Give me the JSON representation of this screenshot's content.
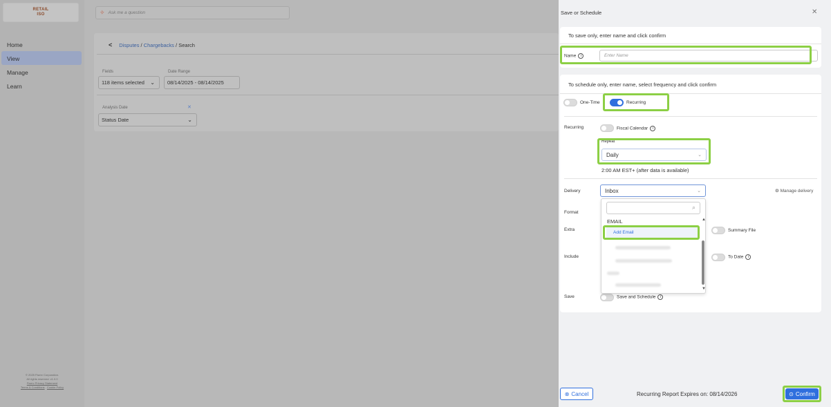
{
  "brand": {
    "line1": "RETAIL",
    "line2": "ISO"
  },
  "search": {
    "placeholder": "Ask me a question"
  },
  "nav": {
    "items": [
      {
        "label": "Home"
      },
      {
        "label": "View"
      },
      {
        "label": "Manage"
      },
      {
        "label": "Learn"
      }
    ],
    "active": "View"
  },
  "footer": {
    "line1": "© 2025 Fiserv Corporation.",
    "line2": "All rights reserved. v1.0.0",
    "line3": "Fiserv Privacy Statement",
    "terms": "Terms & Conditions",
    "cookie": "Cookie Policy"
  },
  "breadcrumb": {
    "part1": "Disputes",
    "sep1": " / ",
    "part2": "Chargebacks",
    "sep2": " / ",
    "current": "Search"
  },
  "filters": {
    "fields_label": "Fields",
    "fields_value": "118 items selected",
    "date_label": "Date Range",
    "date_value": "08/14/2025 - 08/14/2025",
    "analysis_label": "Analysis Date",
    "analysis_value": "Status Date"
  },
  "panel": {
    "title": "Save or Schedule",
    "save_only_title": "To save only, enter name and click confirm",
    "name_label": "Name",
    "name_placeholder": "Enter Name",
    "schedule_title": "To schedule only, enter name, select frequency and click confirm",
    "one_time_label": "One-Time",
    "recurring_toggle_label": "Recurring",
    "recurring_label": "Recurring",
    "fiscal_calendar_label": "Fiscal Calendar",
    "repeat_label": "Repeat",
    "repeat_value": "Daily",
    "schedule_note": "2:00 AM EST+ (after data is available)",
    "delivery_label": "Delivery",
    "delivery_value": "Inbox",
    "manage_delivery": "Manage delivery",
    "format_label": "Format",
    "extra_label": "Extra",
    "summary_file_label": "Summary File",
    "include_label": "Include",
    "to_date_label": "To Date",
    "save_label": "Save",
    "save_and_schedule_label": "Save and Schedule",
    "dropdown": {
      "section": "EMAIL",
      "add_email": "Add Email"
    },
    "cancel_label": "Cancel",
    "expires_text": "Recurring Report Expires on: 08/14/2026",
    "confirm_label": "Confirm"
  },
  "colors": {
    "accent": "#2f6fde",
    "highlight": "#8ccf45",
    "link": "#3a5f9e"
  }
}
